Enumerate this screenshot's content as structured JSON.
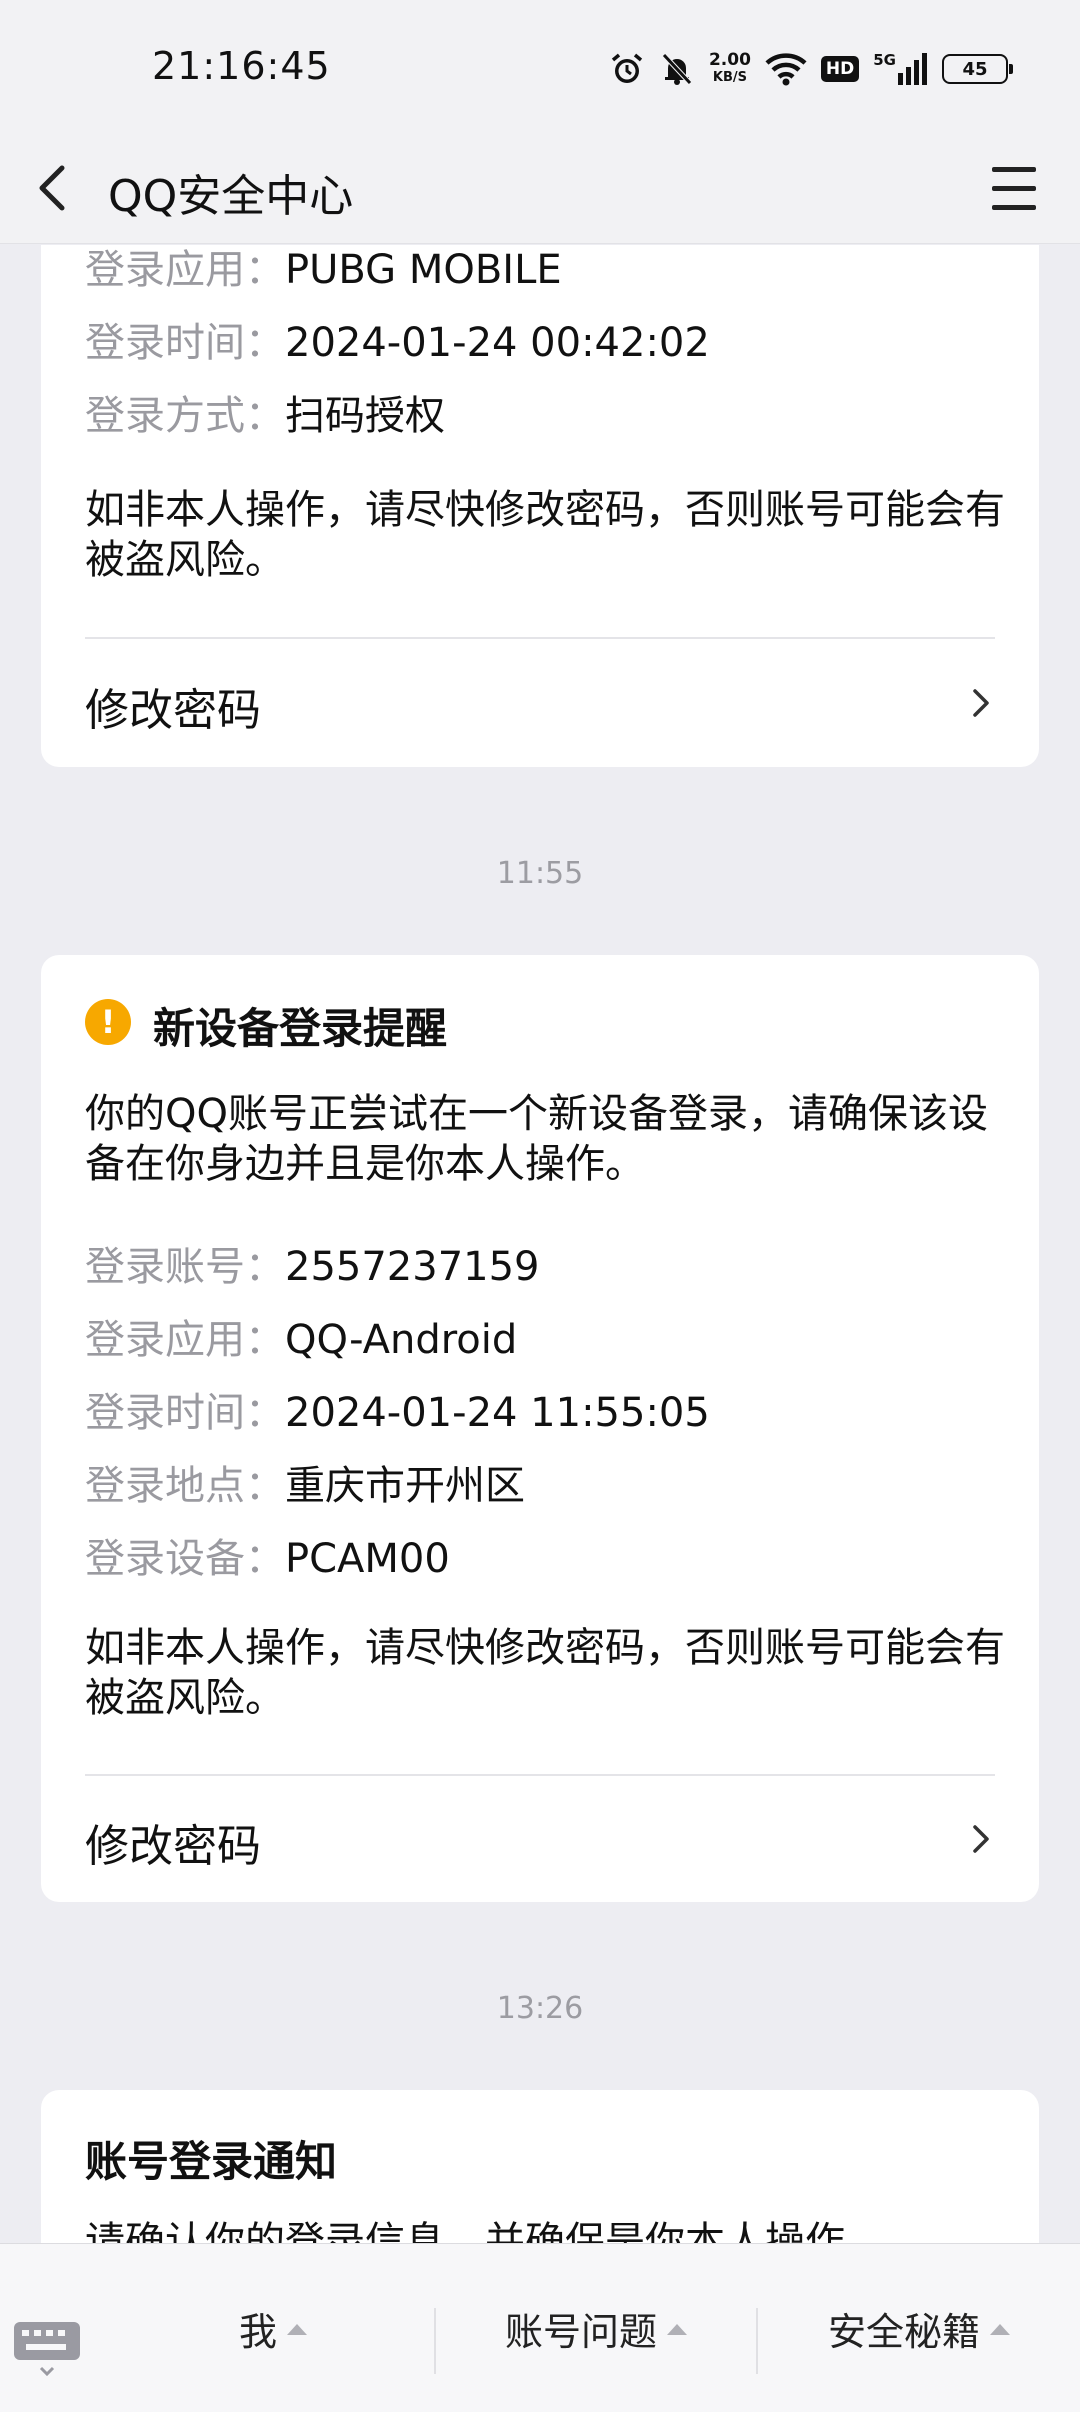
{
  "status_bar": {
    "time": "21:16:45",
    "speed_value": "2.00",
    "speed_unit": "KB/S",
    "network": "5G",
    "hd": "HD",
    "battery": "45",
    "icons": [
      "alarm-icon",
      "bell-muted-icon",
      "wifi-icon",
      "signal-icon"
    ]
  },
  "header": {
    "title": "QQ安全中心",
    "back_icon": "chevron-left-icon",
    "menu_icon": "hamburger-menu-icon"
  },
  "card1": {
    "rows": [
      {
        "key": "登录应用：",
        "value": "PUBG MOBILE"
      },
      {
        "key": "登录时间：",
        "value": "2024-01-24 00:42:02"
      },
      {
        "key": "登录方式：",
        "value": "扫码授权"
      }
    ],
    "warning": "如非本人操作，请尽快修改密码，否则账号可能会有被盗风险。",
    "action": "修改密码"
  },
  "timestamp1": "11:55",
  "card2": {
    "title": "新设备登录提醒",
    "intro": "你的QQ账号正尝试在一个新设备登录，请确保该设备在你身边并且是你本人操作。",
    "rows": [
      {
        "key": "登录账号：",
        "value": "2557237159"
      },
      {
        "key": "登录应用：",
        "value": "QQ-Android"
      },
      {
        "key": "登录时间：",
        "value": "2024-01-24 11:55:05"
      },
      {
        "key": "登录地点：",
        "value": "重庆市开州区"
      },
      {
        "key": "登录设备：",
        "value": "PCAM00"
      }
    ],
    "warning": "如非本人操作，请尽快修改密码，否则账号可能会有被盗风险。",
    "action": "修改密码"
  },
  "timestamp2": "13:26",
  "card3": {
    "title": "账号登录通知",
    "intro": "请确认你的登录信息，并确保是你本人操作。"
  },
  "bottom_bar": {
    "tabs": [
      "我",
      "账号问题",
      "安全秘籍"
    ],
    "keyboard_icon": "keyboard-icon"
  },
  "colors": {
    "background": "#ededf2",
    "card": "#ffffff",
    "warning_icon": "#f7a800",
    "label_gray": "#9a9aa0"
  }
}
